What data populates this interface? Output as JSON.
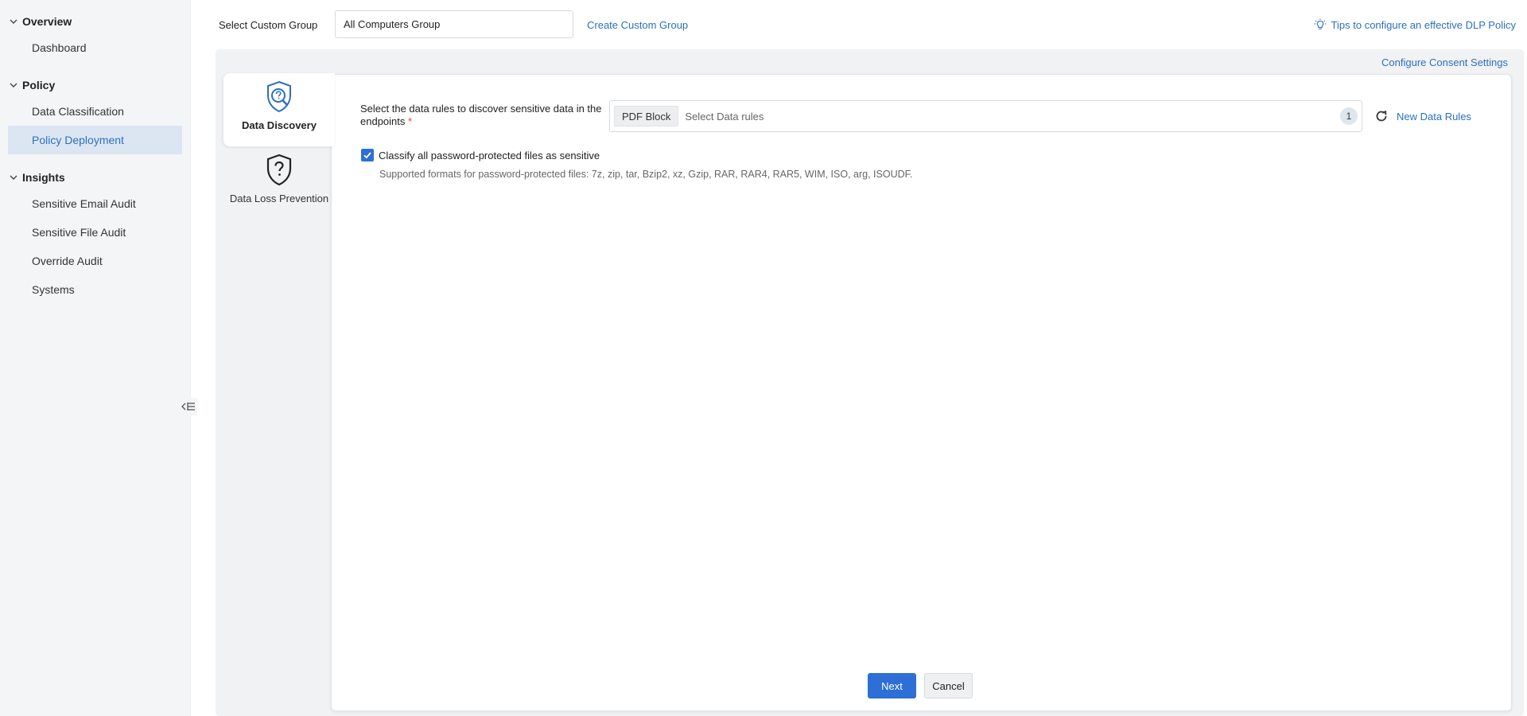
{
  "sidebar": {
    "sections": [
      {
        "title": "Overview",
        "items": [
          "Dashboard"
        ]
      },
      {
        "title": "Policy",
        "items": [
          "Data Classification",
          "Policy Deployment"
        ]
      },
      {
        "title": "Insights",
        "items": [
          "Sensitive Email Audit",
          "Sensitive File Audit",
          "Override Audit",
          "Systems"
        ]
      }
    ],
    "active_item": "Policy Deployment",
    "collapse_icon": "collapse-sidebar-icon"
  },
  "topbar": {
    "group_label": "Select Custom Group",
    "group_value": "All Computers Group",
    "create_group_link": "Create Custom Group",
    "tips_link": "Tips to configure an effective DLP Policy"
  },
  "panel": {
    "consent_link": "Configure Consent Settings",
    "tabs": [
      {
        "label": "Data Discovery",
        "icon": "search-shield-icon"
      },
      {
        "label": "Data Loss Prevention",
        "icon": "question-shield-icon"
      }
    ]
  },
  "form": {
    "rules_label": "Select the data rules to discover sensitive data in the endpoints",
    "required_marker": "*",
    "selected_chip": "PDF Block",
    "rules_placeholder": "Select Data rules",
    "rules_count": "1",
    "new_rules_link": "New Data Rules",
    "classify_checked": true,
    "classify_label": "Classify all password-protected files as sensitive",
    "formats_text": "Supported formats for password-protected files: 7z, zip, tar, Bzip2, xz, Gzip, RAR, RAR4, RAR5, WIM, ISO, arg, ISOUDF."
  },
  "actions": {
    "next_label": "Next",
    "cancel_label": "Cancel"
  },
  "colors": {
    "accent": "#2d6fd6",
    "link": "#2c6fc2",
    "active_nav_bg": "#dce6f2"
  }
}
